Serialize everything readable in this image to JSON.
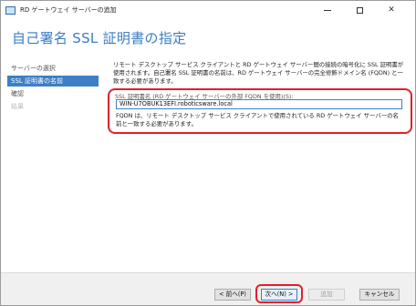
{
  "window": {
    "title": "RD ゲートウェイ サーバーの追加"
  },
  "banner": {
    "title": "自己署名 SSL 証明書の指定"
  },
  "nav": {
    "items": [
      {
        "label": "サーバーの選択"
      },
      {
        "label": "SSL 証明書の名前"
      },
      {
        "label": "確認"
      },
      {
        "label": "結果"
      }
    ]
  },
  "content": {
    "description": "リモート デスクトップ サービス クライアントと RD ゲートウェイ サーバー間の接続の暗号化に SSL 証明書が使用されます。自己署名 SSL 証明書の名前は、RD ゲートウェイ サーバーの完全修飾ドメイン名 (FQDN) と一致する必要があります。",
    "field_label": "SSL 証明書名 (RD ゲートウェイ サーバーの外部 FQDN を使用)(S):",
    "field_value": "WIN-U7OBUK13EFI.roboticsware.local",
    "note": "FQDN は、リモート デスクトップ サービス クライアントで使用されている RD ゲートウェイ サーバーの名前と一致する必要があります。"
  },
  "footer": {
    "prev_label": "< 前へ(P)",
    "next_label": "次へ(N) >",
    "add_label": "追加",
    "cancel_label": "キャンセル"
  },
  "colors": {
    "accent": "#3d7fc6",
    "highlight": "#e0202c"
  }
}
